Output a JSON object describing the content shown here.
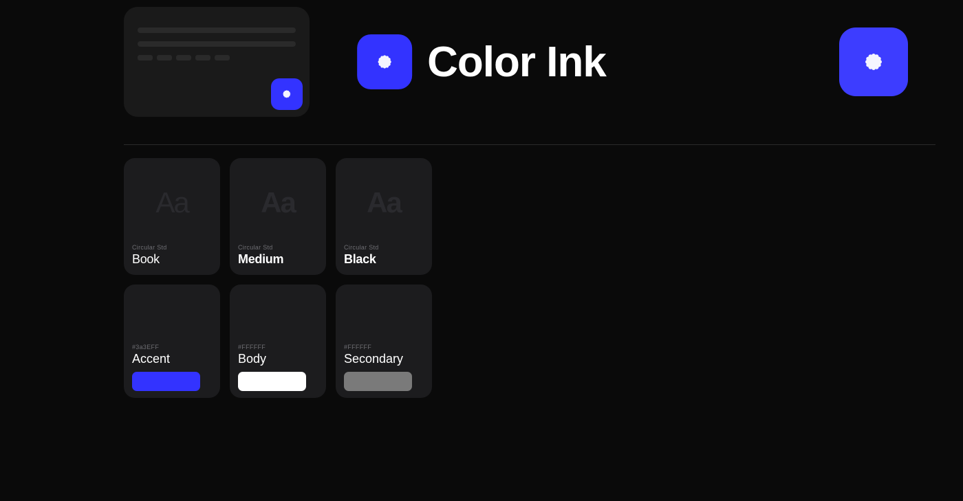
{
  "app": {
    "name": "Color Ink",
    "accent_color": "#3333ff",
    "background": "#0a0a0a"
  },
  "header": {
    "brand_name": "Color Ink"
  },
  "font_cards": [
    {
      "id": "book",
      "label_small": "Circular Std",
      "label_main": "Book",
      "weight": "400"
    },
    {
      "id": "medium",
      "label_small": "Circular Std",
      "label_main": "Medium",
      "weight": "600"
    },
    {
      "id": "black",
      "label_small": "Circular Std",
      "label_main": "Black",
      "weight": "900"
    }
  ],
  "color_cards": [
    {
      "id": "accent",
      "label_small": "#3a3EFF",
      "label_main": "Accent",
      "swatch_class": "swatch-accent"
    },
    {
      "id": "body",
      "label_small": "#FFFFFF",
      "label_main": "Body",
      "swatch_class": "swatch-body"
    },
    {
      "id": "secondary",
      "label_small": "#FFFFFF",
      "label_main": "Secondary",
      "swatch_class": "swatch-secondary"
    }
  ]
}
